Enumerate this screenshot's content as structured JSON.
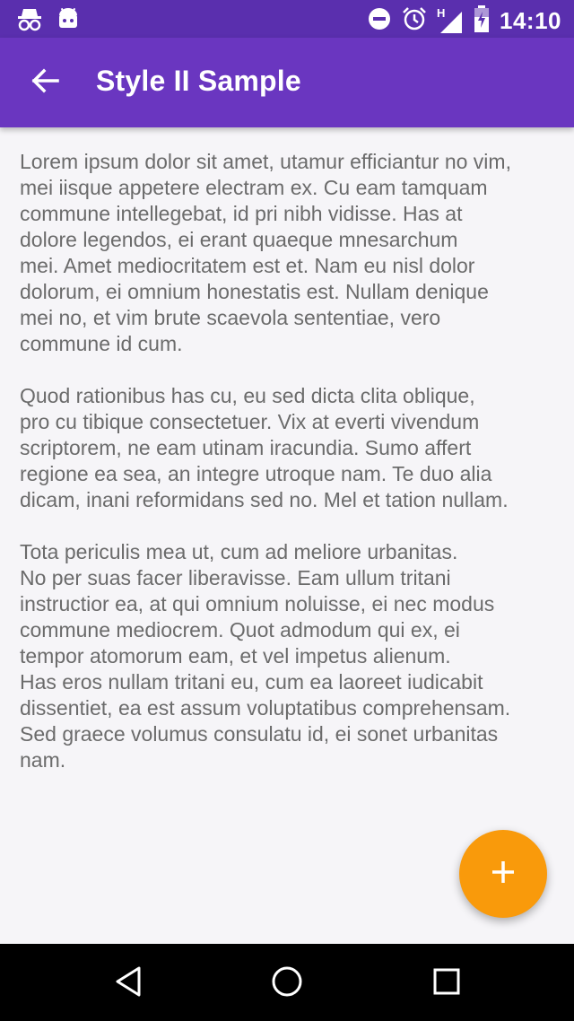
{
  "status_bar": {
    "time": "14:10",
    "icons": [
      "incognito-icon",
      "android-icon",
      "do-not-disturb-icon",
      "alarm-icon",
      "signal-h-icon",
      "battery-icon"
    ],
    "network_label": "H"
  },
  "app_bar": {
    "title": "Style II Sample",
    "back_icon": "arrow-back-icon",
    "background": "#6a36c0"
  },
  "content": {
    "paragraphs": [
      "Lorem ipsum dolor sit amet, utamur efficiantur no vim,\nmei iisque appetere electram ex. Cu eam tamquam\ncommune intellegebat, id pri nibh vidisse. Has at\ndolore legendos, ei erant quaeque mnesarchum\nmei. Amet mediocritatem est et. Nam eu nisl dolor\ndolorum, ei omnium honestatis est. Nullam denique\nmei no, et vim brute scaevola sententiae, vero\ncommune id cum.",
      "Quod rationibus has cu, eu sed dicta clita oblique,\npro cu tibique consectetuer. Vix at everti vivendum\nscriptorem, ne eam utinam iracundia. Sumo affert\nregione ea sea, an integre utroque nam. Te duo alia\ndicam, inani reformidans sed no. Mel et tation nullam.",
      "Tota periculis mea ut, cum ad meliore urbanitas.\nNo per suas facer liberavisse. Eam ullum tritani\ninstructior ea, at qui omnium noluisse, ei nec modus\ncommune mediocrem. Quot admodum qui ex, ei\ntempor atomorum eam, et vel impetus alienum.\nHas eros nullam tritani eu, cum ea laoreet iudicabit\ndissentiet, ea est assum voluptatibus comprehensam.\nSed graece volumus consulatu id, ei sonet urbanitas\nnam."
    ]
  },
  "fab": {
    "icon": "add-icon",
    "color": "#f99a0b"
  },
  "nav_bar": {
    "icons": [
      "back-triangle-icon",
      "home-circle-icon",
      "recents-square-icon"
    ]
  }
}
